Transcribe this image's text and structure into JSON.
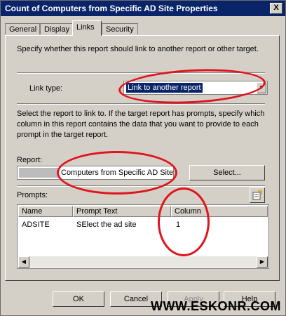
{
  "window": {
    "title": "Count of Computers from Specific AD Site Properties",
    "close_label": "X"
  },
  "tabs": [
    {
      "label": "General"
    },
    {
      "label": "Display"
    },
    {
      "label": "Links"
    },
    {
      "label": "Security"
    }
  ],
  "links": {
    "intro": "Specify whether this report should link to another report or other target.",
    "link_type_label": "Link type:",
    "link_type_value": "Link to another report",
    "instructions": "Select the report to link to. If the target report has prompts, specify which column in this report contains the data that you want to provide to each prompt in the target report.",
    "report_label": "Report:",
    "report_value": "Computers from Specific AD Site",
    "select_button": "Select...",
    "prompts_label": "Prompts:",
    "columns": [
      "Name",
      "Prompt Text",
      "Column"
    ],
    "rows": [
      {
        "name": "ADSITE",
        "prompt_text": "SElect the ad site",
        "column": "1"
      }
    ]
  },
  "footer": {
    "ok": "OK",
    "cancel": "Cancel",
    "apply": "Apply",
    "help": "Help"
  },
  "watermark": "WWW.ESKONR.COM"
}
